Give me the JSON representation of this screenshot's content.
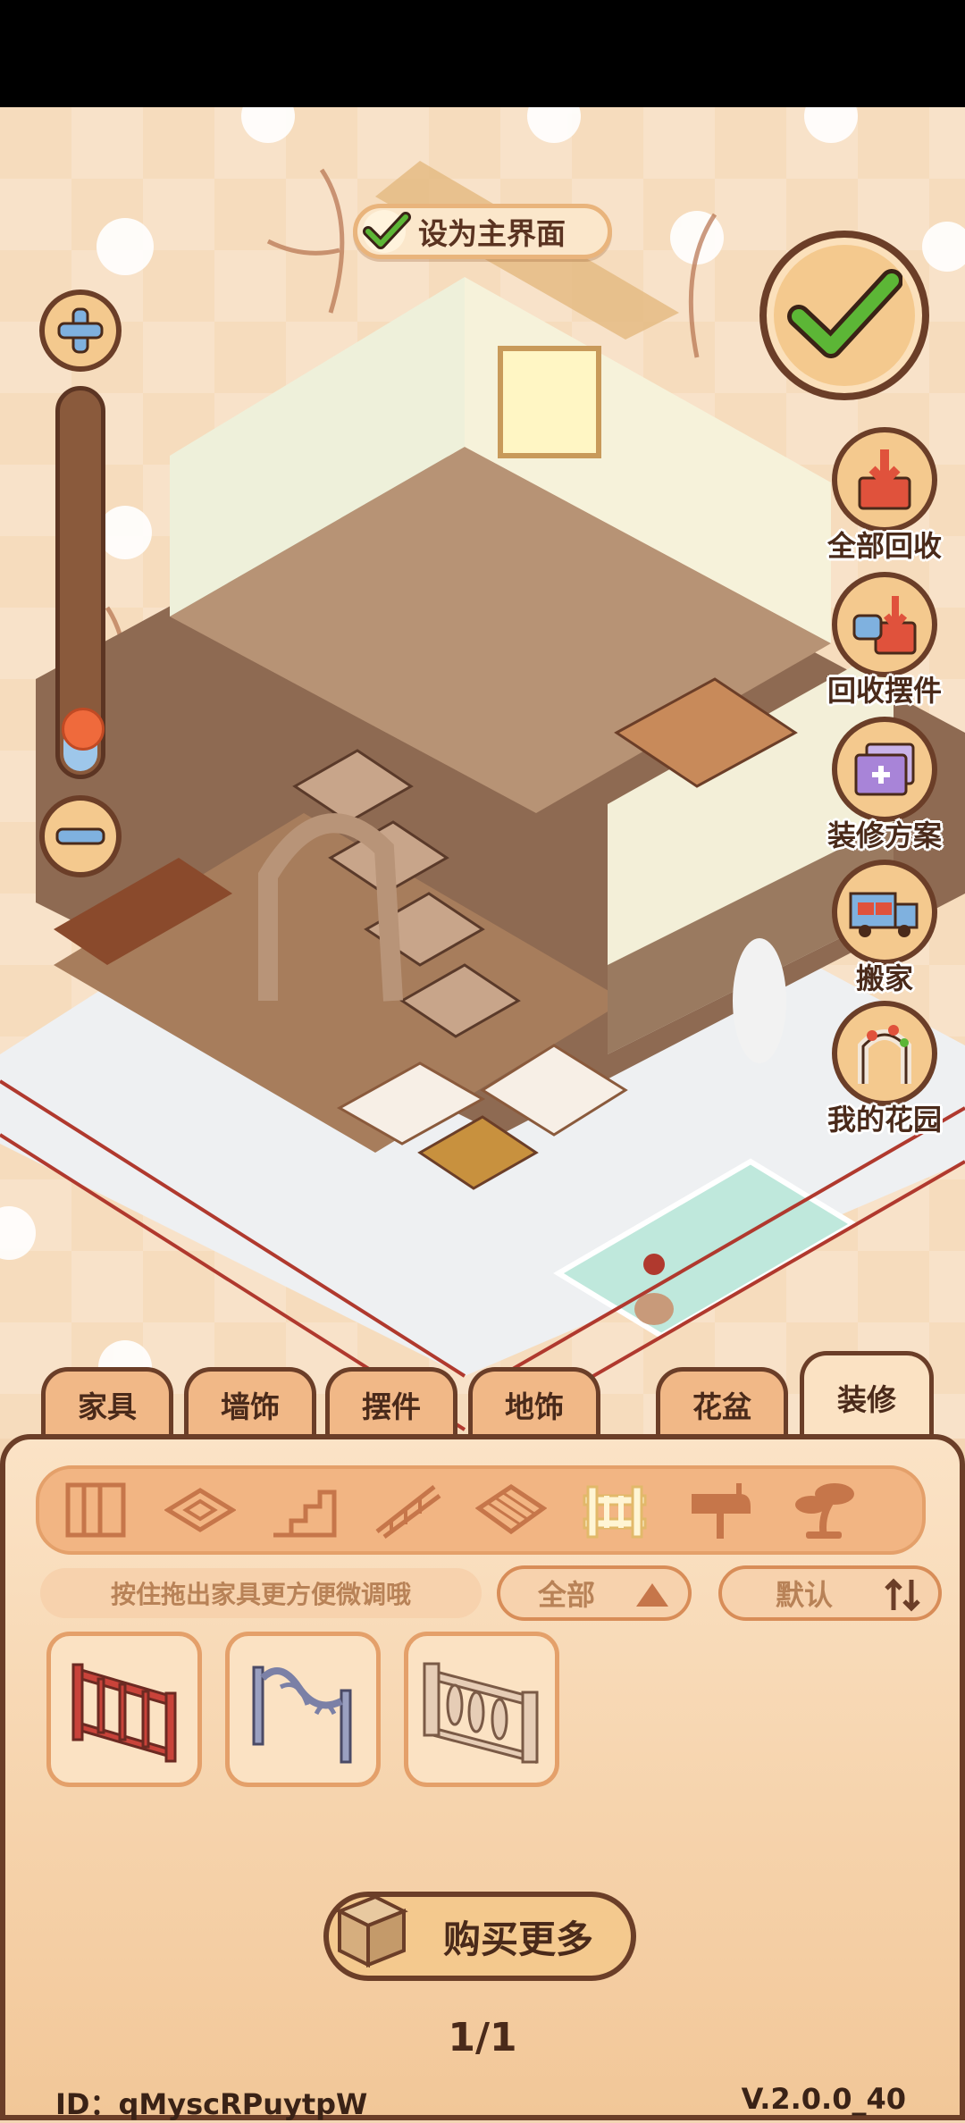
{
  "top_button": {
    "label": "设为主界面"
  },
  "zoom": {
    "level": 0.12
  },
  "side_menu": [
    {
      "label": "全部回收",
      "icon": "recycle-all-icon"
    },
    {
      "label": "回收摆件",
      "icon": "recycle-ornament-icon"
    },
    {
      "label": "装修方案",
      "icon": "plan-icon"
    },
    {
      "label": "搬家",
      "icon": "moving-truck-icon"
    },
    {
      "label": "我的花园",
      "icon": "garden-arch-icon"
    }
  ],
  "tabs": [
    {
      "label": "家具"
    },
    {
      "label": "墙饰"
    },
    {
      "label": "摆件"
    },
    {
      "label": "地饰"
    },
    {
      "label": "花盆"
    },
    {
      "label": "装修",
      "active": true
    }
  ],
  "sub_categories": [
    "wallpaper-icon",
    "floor-tile-icon",
    "stairs-icon",
    "railing-stairs-icon",
    "roof-tile-icon",
    "fence-icon",
    "mailbox-icon",
    "tree-icon"
  ],
  "active_sub_category": "fence-icon",
  "hint": "按住拖出家具更方便微调哦",
  "filter": {
    "label": "全部"
  },
  "sort": {
    "label": "默认"
  },
  "items": [
    {
      "name": "red-fence-icon"
    },
    {
      "name": "iron-arch-fence-icon"
    },
    {
      "name": "stone-baluster-fence-icon"
    }
  ],
  "buy_button": {
    "label": "购买更多"
  },
  "pager": {
    "text": "1/1"
  },
  "footer": {
    "id": "ID：qMyscRPuytpW",
    "version": "V.2.0.0_40"
  },
  "colors": {
    "outline": "#6b3e28",
    "button": "#f4c98e",
    "panel": "#fbe3c6",
    "check": "#5cb636"
  }
}
